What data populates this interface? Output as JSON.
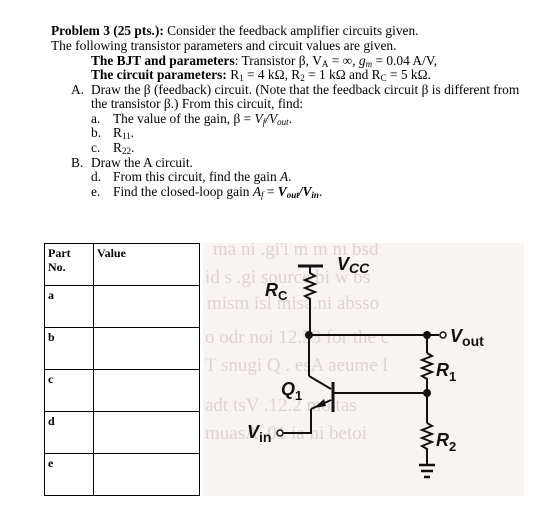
{
  "problem": {
    "title": "Problem 3 (25 pts.):",
    "intro": " Consider the feedback amplifier circuits given.",
    "line2": "The following transistor parameters and circuit values are given.",
    "bjt_label": "The BJT and parameters",
    "bjt_text": ": Transistor β, V",
    "bjt_va_sub": "A",
    "bjt_text2": " = ∞, ",
    "bjt_gm": "g",
    "bjt_gm_sub": "m",
    "bjt_text3": " = 0.04 A/V,",
    "circuit_label": "The circuit parameters:",
    "circuit_r1": " R",
    "circuit_r1_sub": "1",
    "circuit_r1_val": " = 4 kΩ, R",
    "circuit_r2_sub": "2",
    "circuit_r2_val": " = 1 kΩ and R",
    "circuit_rc_sub": "C",
    "circuit_rc_val": " = 5 kΩ."
  },
  "questions": {
    "A": {
      "marker": "A.",
      "text1": "Draw the β (feedback) circuit. (Note that the feedback circuit β is different from",
      "text2": "the transistor β.) From this circuit, find:",
      "items": [
        {
          "marker": "a.",
          "text": "The value of the gain, β = ",
          "math1": "V",
          "sub1": "f",
          "slash": "/",
          "math2": "V",
          "sub2": "out",
          "end": "."
        },
        {
          "marker": "b.",
          "text": "R",
          "sub": "11",
          "end": "."
        },
        {
          "marker": "c.",
          "text": "R",
          "sub": "22",
          "end": "."
        }
      ]
    },
    "B": {
      "marker": "B.",
      "text1": "Draw the A circuit.",
      "items": [
        {
          "marker": "d.",
          "text": "From this circuit, find the gain ",
          "math": "A",
          "end": "."
        },
        {
          "marker": "e.",
          "text": "Find the closed-loop gain ",
          "math1": "A",
          "sub1": "f",
          "eq": " = ",
          "math2": "V",
          "sub2": "out",
          "slash": "/",
          "math3": "V",
          "sub3": "in",
          "end": "."
        }
      ]
    }
  },
  "answer_table": {
    "headers": [
      "Part\nNo.",
      "Value"
    ],
    "header_part_line1": "Part",
    "header_part_line2": "No.",
    "header_value": "Value",
    "rows": [
      {
        "part": "a",
        "value": ""
      },
      {
        "part": "b",
        "value": ""
      },
      {
        "part": "c",
        "value": ""
      },
      {
        "part": "d",
        "value": ""
      },
      {
        "part": "e",
        "value": ""
      }
    ]
  },
  "circuit": {
    "labels": {
      "vcc": "V",
      "vcc_sub": "CC",
      "rc": "R",
      "rc_sub": "C",
      "vout": "V",
      "vout_sub": "out",
      "r1": "R",
      "r1_sub": "1",
      "r2": "R",
      "r2_sub": "2",
      "q1": "Q",
      "q1_sub": "1",
      "vin": "V",
      "vin_sub": "in"
    },
    "ghost_lines": [
      "ma ni .gi'i m m  nı bsd",
      "id s    .gi    source bi    w bs",
      "mism isl misa.ni absso",
      "o odr noi 12.53 for the c",
      "T snugi Q  . esA aeume l",
      "adt tsV  .12.2  mo   tas",
      "muasA .01   ia ni betoi"
    ]
  }
}
